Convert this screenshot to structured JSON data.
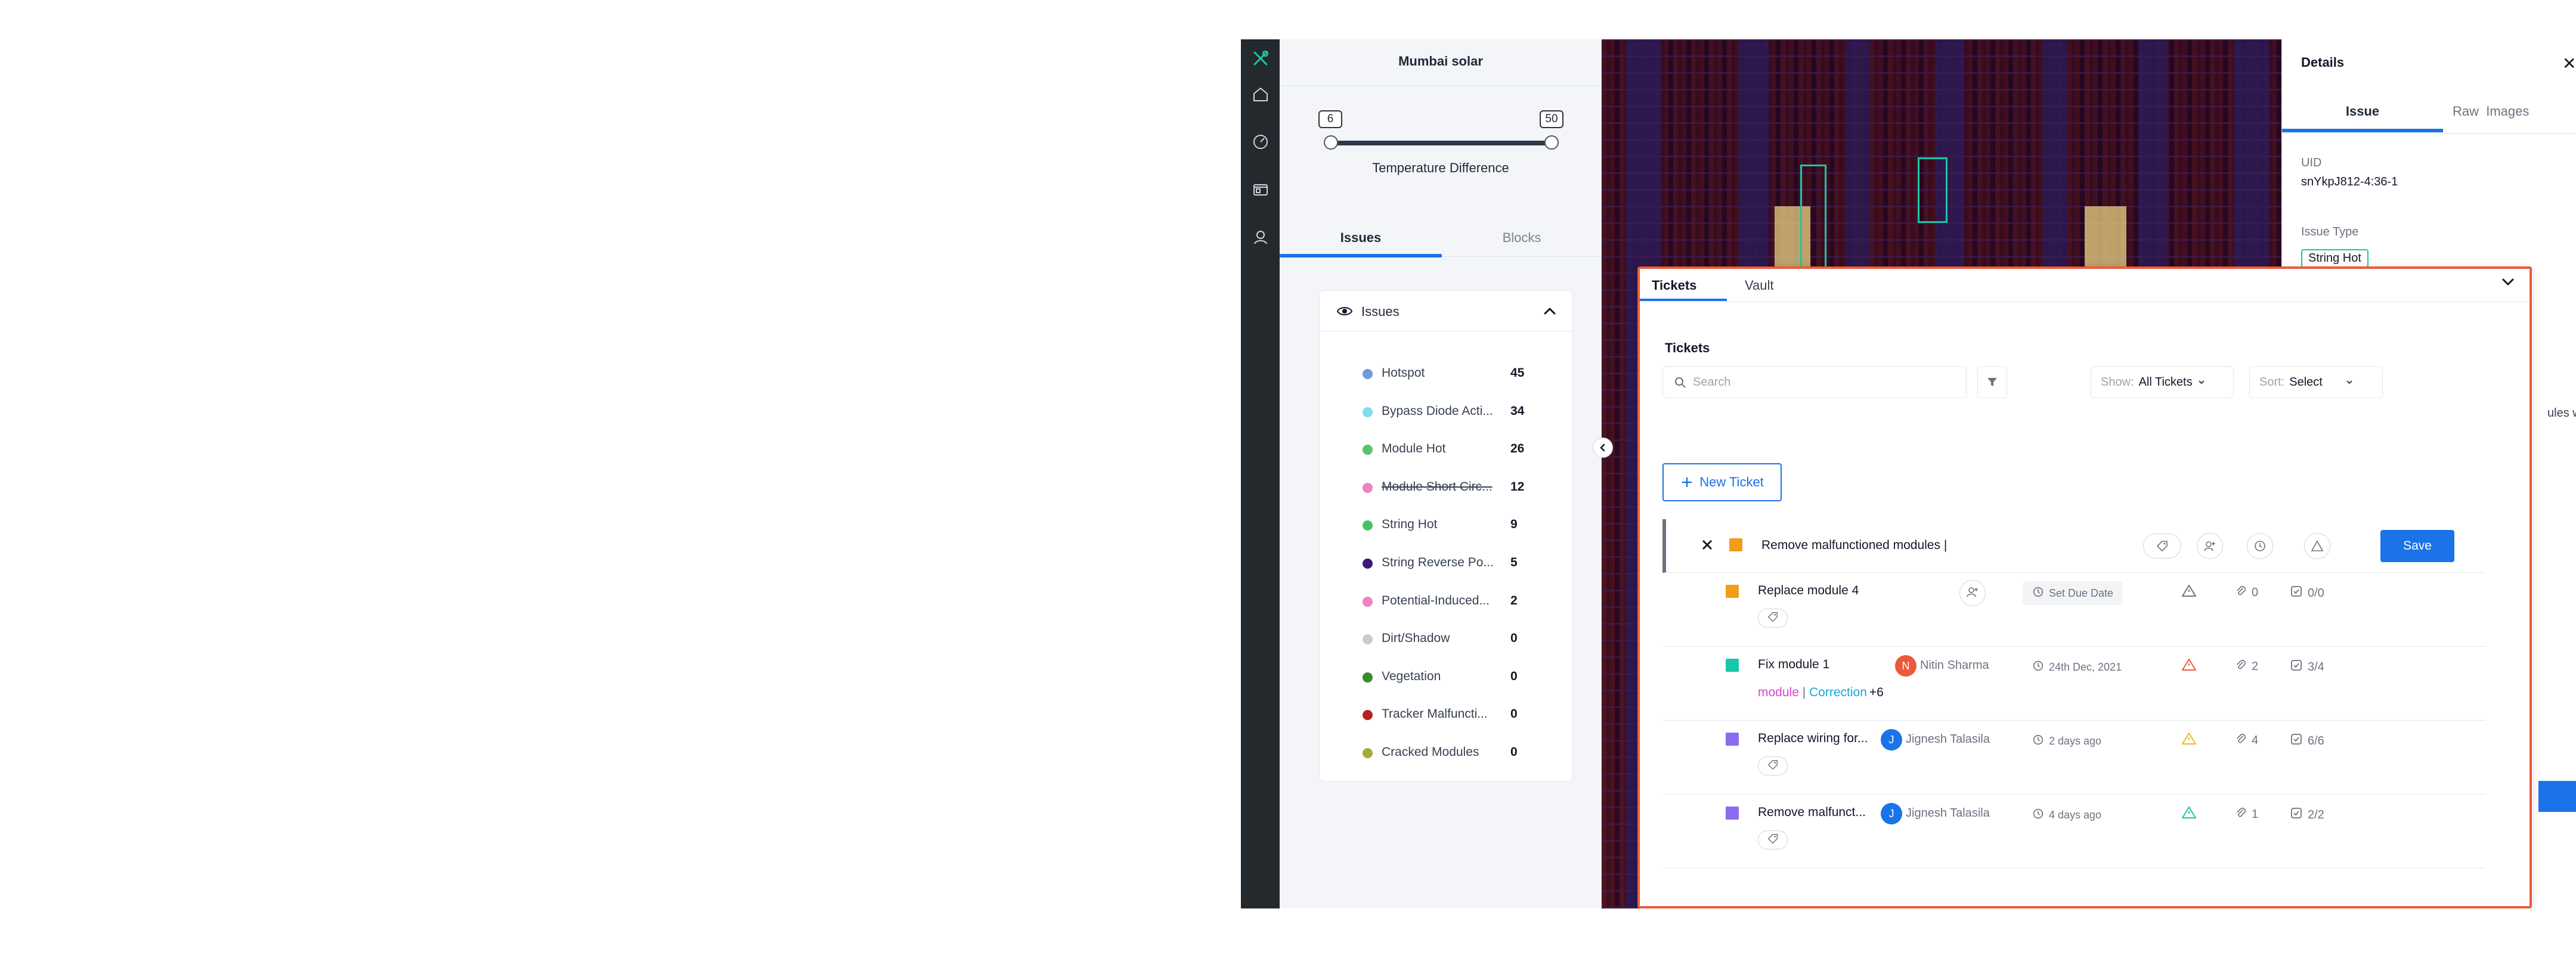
{
  "project": {
    "title": "Mumbai solar"
  },
  "slider": {
    "min": "6",
    "max": "50",
    "label": "Temperature Difference"
  },
  "left_tabs": [
    {
      "label": "Issues"
    },
    {
      "label": "Blocks"
    }
  ],
  "issues_card": {
    "title": "Issues",
    "items": [
      {
        "name": "Hotspot",
        "count": "45",
        "color": "#6f9bd8"
      },
      {
        "name": "Bypass Diode Acti...",
        "count": "34",
        "color": "#7fdcf0"
      },
      {
        "name": "Module Hot",
        "count": "26",
        "color": "#57c472"
      },
      {
        "name": "Module Short Circ...",
        "count": "12",
        "color": "#f080c8"
      },
      {
        "name": "String Hot",
        "count": "9",
        "color": "#4cc068"
      },
      {
        "name": "String Reverse Po...",
        "count": "5",
        "color": "#3b1a7a"
      },
      {
        "name": "Potential-Induced...",
        "count": "2",
        "color": "#f080c8"
      },
      {
        "name": "Dirt/Shadow",
        "count": "0",
        "color": "#c9ccd1"
      },
      {
        "name": "Vegetation",
        "count": "0",
        "color": "#3d8a2a"
      },
      {
        "name": "Tracker Malfuncti...",
        "count": "0",
        "color": "#b72020"
      },
      {
        "name": "Cracked Modules",
        "count": "0",
        "color": "#a3ac3a"
      }
    ]
  },
  "details": {
    "title": "Details",
    "close": "✕",
    "tabs": [
      {
        "label": "Issue"
      },
      {
        "label": "Raw  Images"
      }
    ],
    "uid_label": "UID",
    "uid_value": "snYkpJ812-4:36-1",
    "issue_type_label": "Issue Type",
    "issue_type_value": "String Hot",
    "partial_text": "ules whe"
  },
  "tickets_panel": {
    "tabs": [
      {
        "label": "Tickets"
      },
      {
        "label": "Vault"
      }
    ],
    "heading": "Tickets",
    "search_placeholder": "Search",
    "show_label": "Show:",
    "show_value": "All Tickets",
    "sort_label": "Sort:",
    "sort_value": "Select",
    "new_ticket": "New Ticket",
    "editing": {
      "value": "Remove malfunctioned modules |",
      "save": "Save",
      "color": "#f29d1a"
    },
    "rows": [
      {
        "title": "Replace module 4",
        "color": "#f29d1a",
        "due": "Set Due Date",
        "attachments": "0",
        "checklist": "0/0",
        "priority_color": "#6b7280"
      },
      {
        "title": "Fix module 1",
        "color": "#17c8a6",
        "avatar": "N",
        "avatar_color": "#ec5a3b",
        "assignee": "Nitin Sharma",
        "due": "24th Dec, 2021",
        "attachments": "2",
        "checklist": "3/4",
        "priority_color": "#ec5a3b",
        "label1": "module",
        "label1_color": "#d946c8",
        "sep": " | ",
        "label2": "Correction",
        "label2_color": "#1aa7d8",
        "more": "+6"
      },
      {
        "title": "Replace wiring for...",
        "color": "#8b6cf0",
        "avatar": "J",
        "avatar_color": "#1a73e8",
        "assignee": "Jignesh Talasila",
        "due": "2 days ago",
        "attachments": "4",
        "checklist": "6/6",
        "priority_color": "#f2b91a"
      },
      {
        "title": "Remove malfunct...",
        "color": "#8b6cf0",
        "avatar": "J",
        "avatar_color": "#1a73e8",
        "assignee": "Jignesh Talasila",
        "due": "4 days ago",
        "attachments": "1",
        "checklist": "2/2",
        "priority_color": "#17c8a6"
      }
    ]
  },
  "colors": {
    "accent": "#1a73e8",
    "highlight_border": "#ec5a3b",
    "detection_box": "#17c8a6",
    "rail": "#24292e"
  }
}
